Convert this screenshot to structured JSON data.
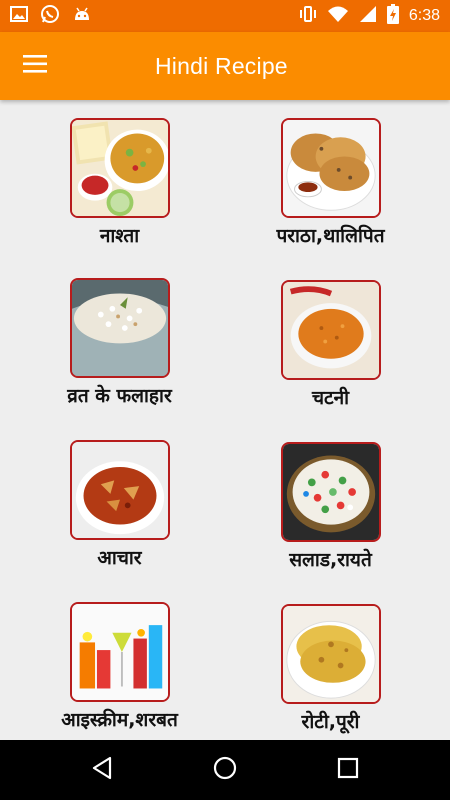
{
  "status_bar": {
    "time": "6:38",
    "left_icons": [
      "image-icon",
      "whatsapp-icon",
      "android-icon"
    ],
    "right_icons": [
      "vibrate-icon",
      "wifi-icon",
      "signal-icon",
      "battery-charging-icon"
    ]
  },
  "app_bar": {
    "title": "Hindi Recipe",
    "menu_icon": "hamburger-menu-icon",
    "color": "#fb8c00"
  },
  "categories": [
    {
      "label": "नाश्ता",
      "image": "breakfast-image"
    },
    {
      "label": "पराठा,थालिपित",
      "image": "paratha-image"
    },
    {
      "label": "व्रत के फलाहार",
      "image": "fasting-food-image"
    },
    {
      "label": "चटनी",
      "image": "chutney-image"
    },
    {
      "label": "आचार",
      "image": "pickle-image"
    },
    {
      "label": "सलाड,रायते",
      "image": "salad-image"
    },
    {
      "label": "आइस्क्रीम,शरबत",
      "image": "drinks-image"
    },
    {
      "label": "रोटी,पूरी",
      "image": "roti-image"
    }
  ],
  "nav_bar": {
    "buttons": [
      "back-icon",
      "home-icon",
      "recents-icon"
    ]
  },
  "colors": {
    "status_bar": "#ef6c00",
    "app_bar": "#fb8c00",
    "background": "#eeeeee",
    "thumb_border": "#b71c1c"
  }
}
